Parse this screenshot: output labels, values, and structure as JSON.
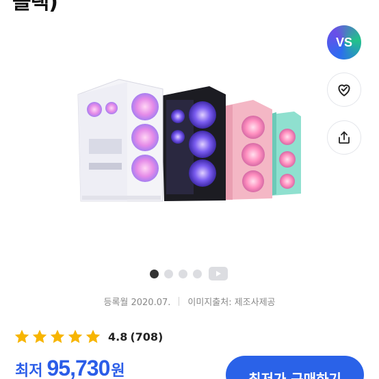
{
  "title_fragment": "블랙)",
  "side_buttons": {
    "compare_label": "VS"
  },
  "gallery": {
    "dot_count": 4,
    "active_index": 0
  },
  "meta": {
    "registered": "등록월 2020.07.",
    "image_source": "이미지출처: 제조사제공"
  },
  "rating": {
    "stars": 5,
    "score": "4.8",
    "count": "(708)"
  },
  "price": {
    "label": "최저",
    "value": "95,730",
    "unit": "원"
  },
  "buy_button": {
    "label": "최저가 구매하기"
  },
  "colors": {
    "accent": "#2a62e8",
    "star": "#f7b500"
  }
}
